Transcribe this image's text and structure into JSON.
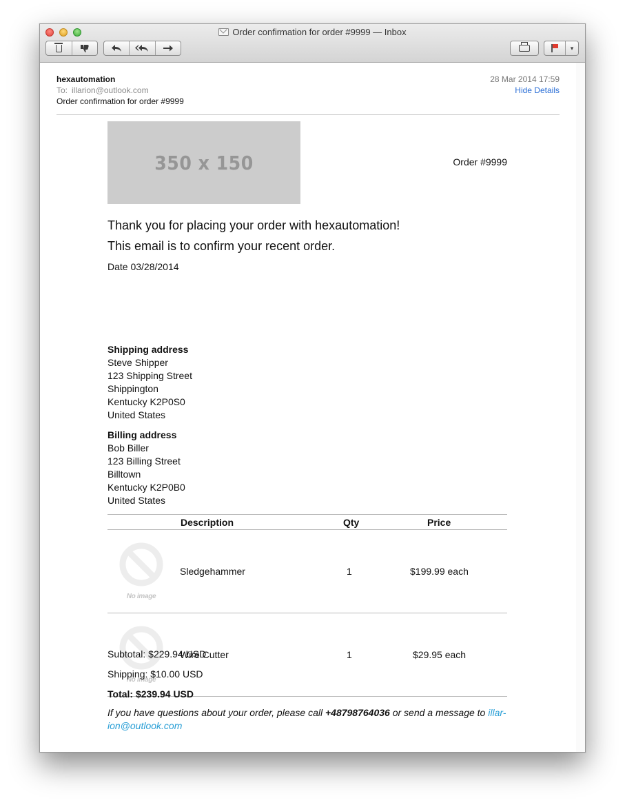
{
  "window": {
    "title": "Order confirmation for order #9999 — Inbox"
  },
  "toolbar": {
    "delete_icon": "trash-icon",
    "junk_icon": "thumbs-down-icon",
    "reply_glyph": "↩",
    "reply_all_glyph": "⇇",
    "forward_glyph": "→",
    "print_icon": "printer-icon",
    "flag_icon": "flag-icon",
    "flag_caret": "▾"
  },
  "header": {
    "from": "hexautomation",
    "to_label": "To:",
    "to": "illarion@outlook.com",
    "subject": "Order confirmation for order #9999",
    "date": "28 Mar 2014 17:59",
    "hide_details": "Hide Details"
  },
  "email": {
    "logo_placeholder": "350 x 150",
    "order_number": "Order #9999",
    "thanks": "Thank you for placing your order with hexautomation!",
    "confirm": "This email is to confirm your recent order.",
    "date": "Date 03/28/2014",
    "shipping": {
      "heading": "Shipping address",
      "name": "Steve Shipper",
      "street": "123 Shipping Street",
      "city": "Shippington",
      "region": "Kentucky K2P0S0",
      "country": "United States"
    },
    "billing": {
      "heading": "Billing address",
      "name": "Bob Biller",
      "street": "123 Billing Street",
      "city": "Billtown",
      "region": "Kentucky K2P0B0",
      "country": "United States"
    },
    "table": {
      "headers": {
        "description": "Description",
        "qty": "Qty",
        "price": "Price"
      },
      "rows": [
        {
          "no_image": "No image",
          "description": "Sledgehammer",
          "qty": "1",
          "price": "$199.99 each"
        },
        {
          "no_image": "No image",
          "description": "Wire Cutter",
          "qty": "1",
          "price": "$29.95 each"
        }
      ]
    },
    "subtotal": "Subtotal: $229.94 USD",
    "shipping_cost": "Shipping: $10.00 USD",
    "total": "Total: $239.94 USD",
    "footer": {
      "before_phone": "If you have questions about your order, please call ",
      "phone": "+48798764036",
      "middle": " or send a message to ",
      "email_part1": "illar-",
      "email_part2": "ion@outlook.com"
    }
  },
  "colors": {
    "link": "#2a6ed6",
    "footer_link": "#2a9fd6",
    "placeholder_bg": "#cccccc",
    "placeholder_text": "#969696"
  }
}
